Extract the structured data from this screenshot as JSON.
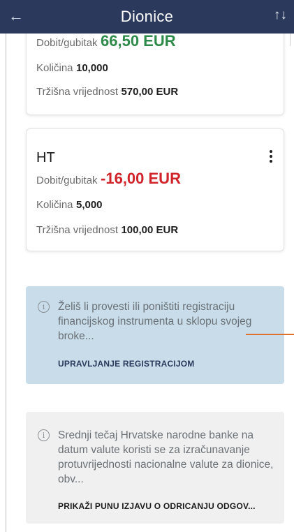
{
  "header": {
    "title": "Dionice",
    "back_icon": "←",
    "sort_icon": "↑↓",
    "bg_color": "#2b3a5c"
  },
  "card1": {
    "pl_label": "Dobit/gubitak",
    "pl_value": "66,50 EUR",
    "qty_label": "Količina",
    "qty_value": "10,000",
    "mv_label": "Tržišna vrijednost",
    "mv_value": "570,00 EUR"
  },
  "card2": {
    "name": "HT",
    "pl_label": "Dobit/gubitak",
    "pl_value": "-16,00 EUR",
    "qty_label": "Količina",
    "qty_value": "5,000",
    "mv_label": "Tržišna vrijednost",
    "mv_value": "100,00 EUR",
    "menu_icon": "more-vertical-icon"
  },
  "info_blue": {
    "icon": "ⓘ",
    "text": "Želiš li provesti ili poništiti registraciju financijskog instrumenta u sklopu svojeg broke...",
    "link": "UPRAVLJANJE REGISTRACIJOM"
  },
  "info_grey": {
    "icon": "ⓘ",
    "text": "Srednji tečaj Hrvatske narodne banke na datum valute koristi se za izračunavanje protuvrijednosti nacionalne valute za dionice, obv...",
    "link": "PRIKAŽI PUNU IZJAVU O ODRICANJU ODGOV..."
  },
  "colors": {
    "positive": "#2e8a48",
    "negative": "#d1232a",
    "info_blue_bg": "#c8dde9",
    "info_grey_bg": "#f0f0f0",
    "accent_line": "#e0712b"
  }
}
